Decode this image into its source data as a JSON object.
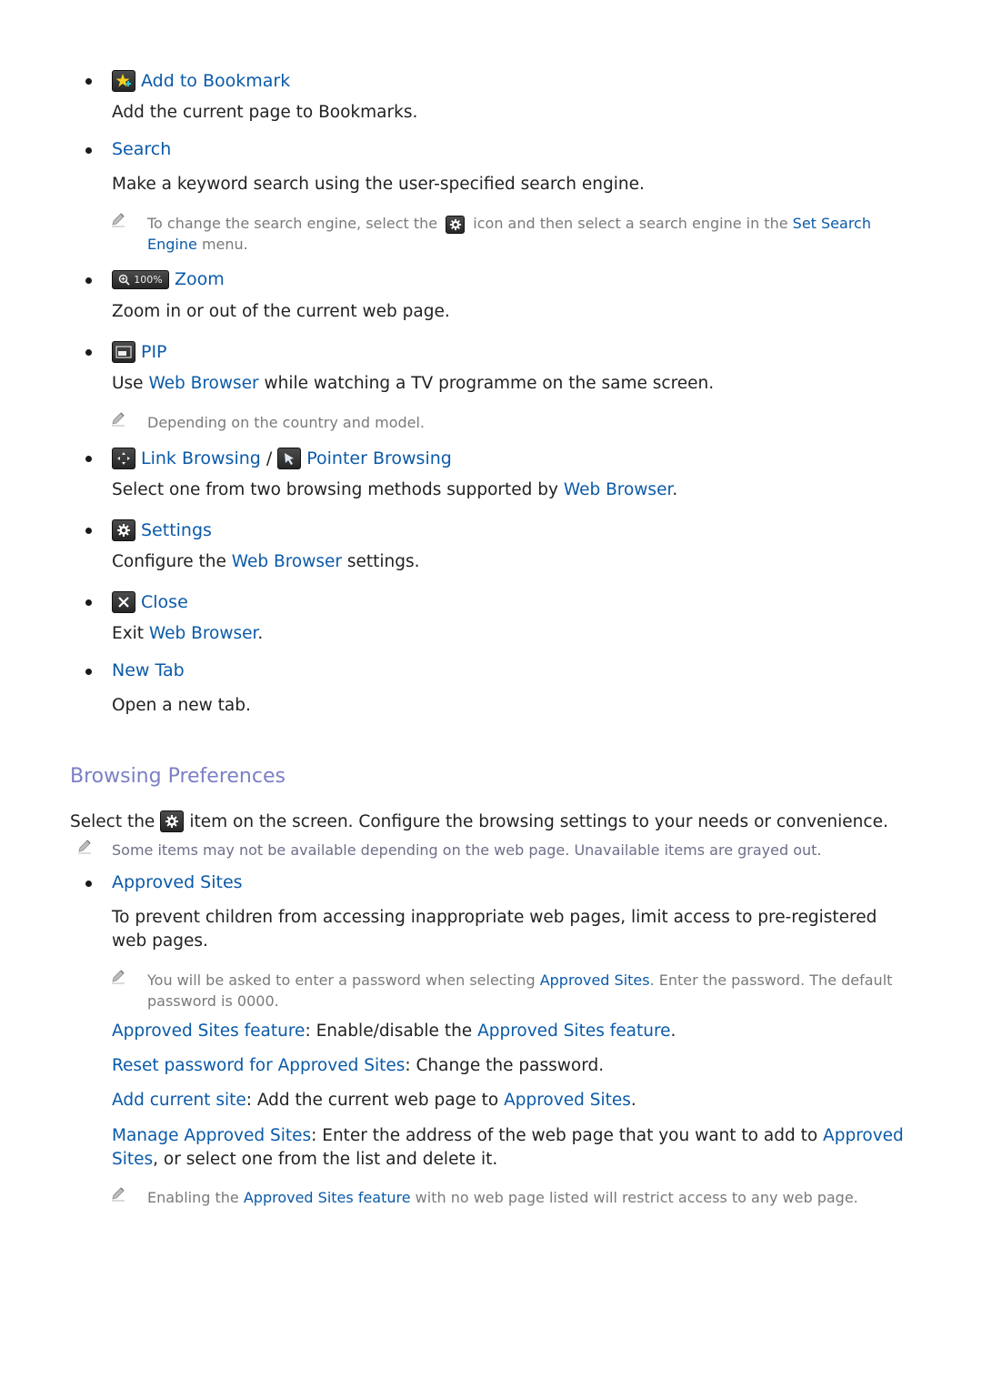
{
  "colors": {
    "link": "#0b5aa8",
    "heading": "#7b7fc4",
    "body_text": "#222222",
    "note_text": "#7a7a7a",
    "icon_bg": "#333333"
  },
  "items": [
    {
      "icon": "add-bookmark-icon",
      "title": "Add to Bookmark",
      "desc": "Add the current page to Bookmarks."
    },
    {
      "title": "Search",
      "desc": "Make a keyword search using the user-specified search engine.",
      "note": {
        "pre": "To change the search engine, select the",
        "icon": "gear-icon",
        "mid": "icon and then select a search engine in the",
        "link": "Set Search Engine",
        "post": "menu."
      }
    },
    {
      "icon": "zoom-icon",
      "icon_label": "100%",
      "title": "Zoom",
      "desc": "Zoom in or out of the current web page."
    },
    {
      "icon": "pip-icon",
      "title": "PIP",
      "desc_pre": "Use",
      "desc_link": "Web Browser",
      "desc_post": "while watching a TV programme on the same screen.",
      "note": "Depending on the country and model."
    },
    {
      "icon": "link-browsing-icon",
      "title": "Link Browsing",
      "separator": "/",
      "icon2": "pointer-browsing-icon",
      "title2": "Pointer Browsing",
      "desc_pre": "Select one from two browsing methods supported by",
      "desc_link": "Web Browser",
      "desc_post": "."
    },
    {
      "icon": "gear-icon",
      "title": "Settings",
      "desc_pre": "Configure the",
      "desc_link": "Web Browser",
      "desc_post": "settings."
    },
    {
      "icon": "close-icon",
      "title": "Close",
      "desc_pre": "Exit",
      "desc_link": "Web Browser",
      "desc_post": "."
    },
    {
      "title": "New Tab",
      "desc": "Open a new tab."
    }
  ],
  "browsing_preferences": {
    "heading": "Browsing Preferences",
    "intro_pre": "Select the",
    "intro_icon": "gear-icon",
    "intro_post": "item on the screen. Configure the browsing settings to your needs or convenience.",
    "intro_note": "Some items may not be available depending on the web page. Unavailable items are grayed out.",
    "approved_sites": {
      "title": "Approved Sites",
      "desc": "To prevent children from accessing inappropriate web pages, limit access to pre-registered web pages.",
      "note": {
        "pre": "You will be asked to enter a password when selecting",
        "link": "Approved Sites",
        "post": ". Enter the password. The default password is 0000."
      },
      "options": [
        {
          "label": "Approved Sites feature",
          "text_pre": ": Enable/disable the",
          "text_link": "Approved Sites feature",
          "text_post": "."
        },
        {
          "label": "Reset password for Approved Sites",
          "text_pre": ": Change the password.",
          "text_link": "",
          "text_post": ""
        },
        {
          "label": "Add current site",
          "text_pre": ": Add the current web page to",
          "text_link": "Approved Sites",
          "text_post": "."
        },
        {
          "label": "Manage Approved Sites",
          "text_pre": ": Enter the address of the web page that you want to add to",
          "text_link": "Approved Sites",
          "text_post": ", or select one from the list and delete it."
        }
      ],
      "final_note": {
        "pre": "Enabling the",
        "link": "Approved Sites feature",
        "post": "with no web page listed will restrict access to any web page."
      }
    }
  }
}
